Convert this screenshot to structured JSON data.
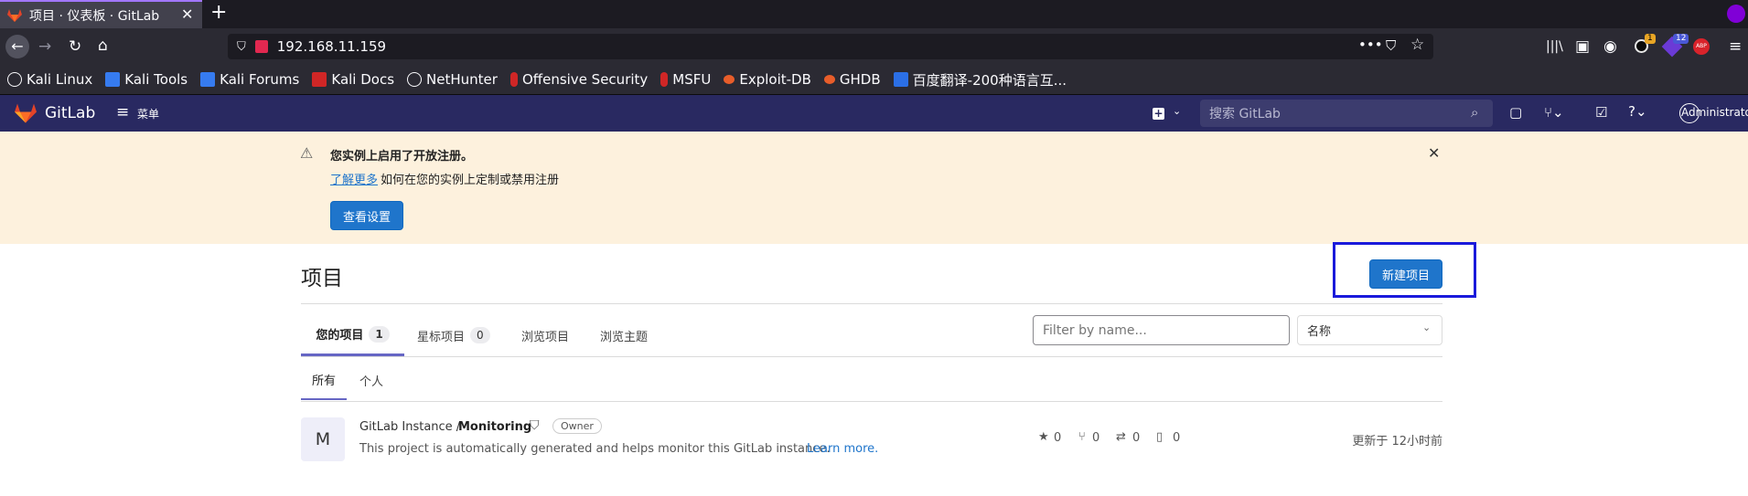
{
  "browser": {
    "tab_title": "项目 · 仪表板 · GitLab",
    "new_tab": "+",
    "address": "192.168.11.159",
    "badges": {
      "ext1": "1",
      "ext2": "12",
      "abp": "ABP"
    },
    "bookmarks": [
      "Kali Linux",
      "Kali Tools",
      "Kali Forums",
      "Kali Docs",
      "NetHunter",
      "Offensive Security",
      "MSFU",
      "Exploit-DB",
      "GHDB",
      "百度翻译-200种语言互..."
    ]
  },
  "header": {
    "brand": "GitLab",
    "menu": "菜单",
    "search_placeholder": "搜索 GitLab",
    "user": "Administrator"
  },
  "banner": {
    "title": "您实例上启用了开放注册。",
    "link": "了解更多",
    "text": "如何在您的实例上定制或禁用注册",
    "button": "查看设置"
  },
  "page": {
    "title": "项目",
    "new_project": "新建项目",
    "tabs": [
      {
        "label": "您的项目",
        "count": "1"
      },
      {
        "label": "星标项目",
        "count": "0"
      },
      {
        "label": "浏览项目"
      },
      {
        "label": "浏览主题"
      }
    ],
    "filter_placeholder": "Filter by name...",
    "sort": "名称",
    "subtabs": [
      "所有",
      "个人"
    ]
  },
  "project": {
    "avatar": "M",
    "namespace": "GitLab Instance / ",
    "name": "Monitoring",
    "role": "Owner",
    "description": "This project is automatically generated and helps monitor this GitLab instance.",
    "learn_more": "Learn more.",
    "stars": "0",
    "forks": "0",
    "merge_requests": "0",
    "issues": "0",
    "updated": "更新于 12小时前"
  },
  "colors": {
    "gitlab_header": "#292961",
    "banner": "#fdf1dd",
    "primary": "#1f75cb",
    "highlight_box": "#1a1adb"
  }
}
